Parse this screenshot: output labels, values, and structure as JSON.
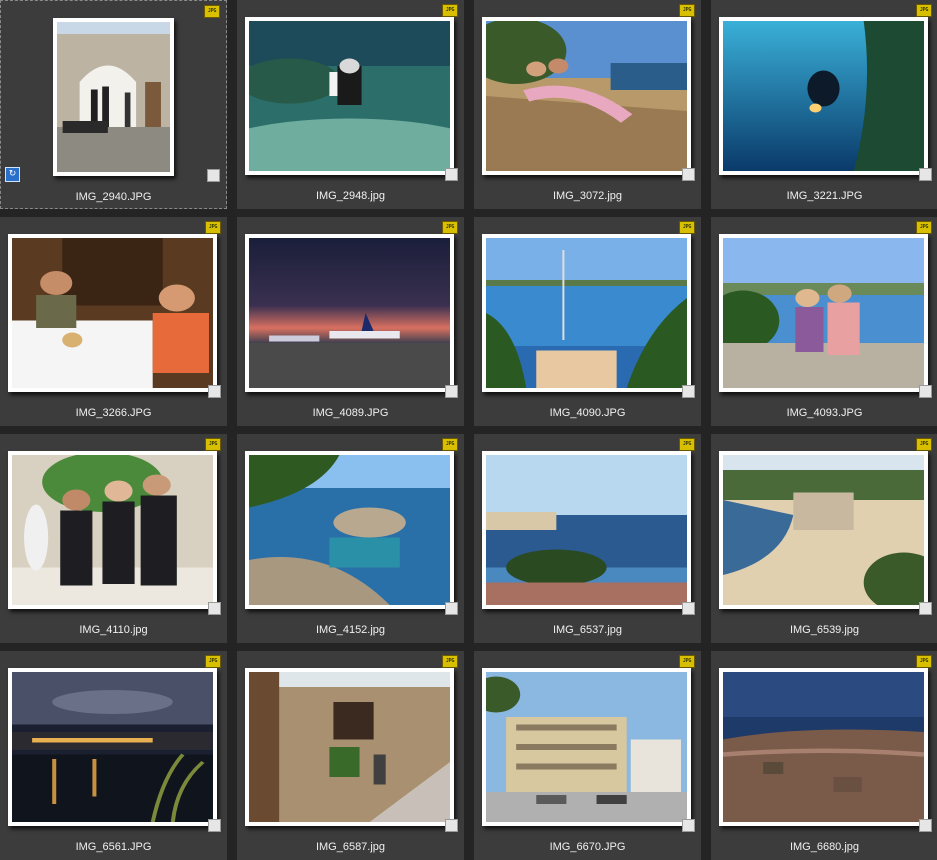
{
  "badge_text": "JPG",
  "thumbnails": [
    {
      "filename": "IMG_2940.JPG",
      "thumbnail_icon": "photo-divers-at-building-icon",
      "orientation": "portrait",
      "selected": true
    },
    {
      "filename": "IMG_2948.jpg",
      "thumbnail_icon": "photo-diver-underwater-icon",
      "orientation": "landscape",
      "selected": false
    },
    {
      "filename": "IMG_3072.jpg",
      "thumbnail_icon": "photo-couple-on-rocks-icon",
      "orientation": "landscape",
      "selected": false
    },
    {
      "filename": "IMG_3221.JPG",
      "thumbnail_icon": "photo-diver-blue-water-icon",
      "orientation": "landscape",
      "selected": false
    },
    {
      "filename": "IMG_3266.JPG",
      "thumbnail_icon": "photo-dinner-table-icon",
      "orientation": "landscape",
      "selected": false
    },
    {
      "filename": "IMG_4089.JPG",
      "thumbnail_icon": "photo-ryanair-planes-dusk-icon",
      "orientation": "landscape",
      "selected": false
    },
    {
      "filename": "IMG_4090.JPG",
      "thumbnail_icon": "photo-bay-with-boats-icon",
      "orientation": "landscape",
      "selected": false
    },
    {
      "filename": "IMG_4093.JPG",
      "thumbnail_icon": "photo-couple-seaside-wall-icon",
      "orientation": "landscape",
      "selected": false
    },
    {
      "filename": "IMG_4110.jpg",
      "thumbnail_icon": "photo-three-divers-wetsuits-icon",
      "orientation": "landscape",
      "selected": false
    },
    {
      "filename": "IMG_4152.jpg",
      "thumbnail_icon": "photo-rocky-coast-icon",
      "orientation": "landscape",
      "selected": false
    },
    {
      "filename": "IMG_6537.jpg",
      "thumbnail_icon": "photo-harbor-town-icon",
      "orientation": "landscape",
      "selected": false
    },
    {
      "filename": "IMG_6539.jpg",
      "thumbnail_icon": "photo-beach-cove-icon",
      "orientation": "landscape",
      "selected": false
    },
    {
      "filename": "IMG_6561.JPG",
      "thumbnail_icon": "photo-town-at-night-icon",
      "orientation": "landscape",
      "selected": false
    },
    {
      "filename": "IMG_6587.jpg",
      "thumbnail_icon": "photo-stone-street-icon",
      "orientation": "landscape",
      "selected": false
    },
    {
      "filename": "IMG_6670.JPG",
      "thumbnail_icon": "photo-apartment-building-icon",
      "orientation": "landscape",
      "selected": false
    },
    {
      "filename": "IMG_6680.jpg",
      "thumbnail_icon": "photo-aerial-coast-icon",
      "orientation": "landscape",
      "selected": false
    }
  ]
}
